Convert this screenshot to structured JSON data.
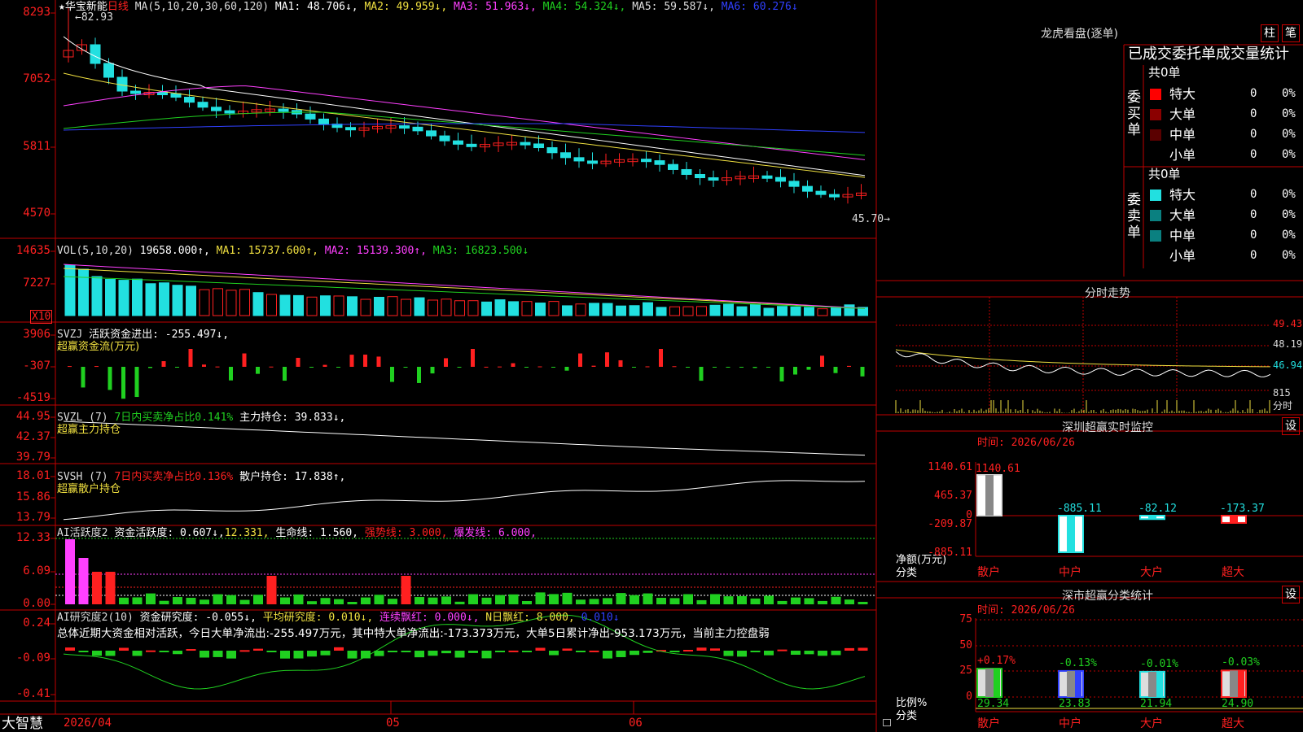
{
  "colors": {
    "up": "#ff2020",
    "down": "#22e0e0",
    "green": "#20d020",
    "grid": "#c00000",
    "yellow": "#f0e040",
    "magenta": "#ff40ff",
    "blue": "#3040ff",
    "white": "#ffffff"
  },
  "app": {
    "name": "大智慧"
  },
  "kline": {
    "yaxis": [
      "8293",
      "7052",
      "5811",
      "4570"
    ],
    "header": {
      "star": "★",
      "stock": "华宝新能",
      "period": "日线",
      "ma_params": "MA(5,10,20,30,60,120)",
      "ma1": "MA1: 48.706↓,",
      "ma2": "MA2: 49.959↓,",
      "ma3": "MA3: 51.963↓,",
      "ma4": "MA4: 54.324↓,",
      "ma5": "MA5: 59.587↓,",
      "ma6": "MA6: 60.276↓"
    },
    "high_label": "82.93",
    "low_label": "45.70"
  },
  "vol": {
    "yaxis": [
      "14635",
      "7227"
    ],
    "unit": "X10",
    "header": {
      "name": "VOL(5,10,20)",
      "val": "19658.000↑,",
      "ma1": "MA1: 15737.600↑,",
      "ma2": "MA2: 15139.300↑,",
      "ma3": "MA3: 16823.500↓"
    }
  },
  "svzj": {
    "yaxis": [
      "3906",
      "-307",
      "-4519"
    ],
    "header": {
      "name": "SVZJ",
      "flow": "活跃资金进出: -255.497↓,",
      "sub": "超赢资金流(万元)"
    }
  },
  "svzl": {
    "yaxis": [
      "44.95",
      "42.37",
      "39.79"
    ],
    "header": {
      "name": "SVZL (7)",
      "ratio": "7日内买卖净占比0.141%",
      "hold": "主力持仓: 39.833↓,",
      "sub": "超赢主力持仓"
    }
  },
  "svsh": {
    "yaxis": [
      "18.01",
      "15.86",
      "13.79"
    ],
    "header": {
      "name": "SVSH (7)",
      "ratio": "7日内买卖净占比0.136%",
      "hold": "散户持仓: 17.838↑,",
      "sub": "超赢散户持仓"
    }
  },
  "ai1": {
    "yaxis": [
      "12.33",
      "6.09",
      "0.00"
    ],
    "header": {
      "name": "AI活跃度2",
      "act": "资金活跃度: 0.607↓,",
      "v2": "12.331,",
      "life": "生命线: 1.560,",
      "strong": "强势线: 3.000,",
      "burst": "爆发线: 6.000,"
    }
  },
  "ai2": {
    "yaxis": [
      "0.24",
      "-0.09",
      "-0.41"
    ],
    "header": {
      "name": "AI研究度2(10)",
      "res": "资金研究度: -0.055↓,",
      "avg": "平均研究度: 0.010↓,",
      "red": "连续飘红: 0.000↓,",
      "nred": "N日飘红: 8.000,",
      "last": "0.010↓"
    },
    "summary": "总体近期大资金相对活跃，今日大单净流出:-255.497万元，其中特大单净流出:-173.373万元，大单5日累计净出-953.173万元，当前主力控盘弱"
  },
  "xaxis": {
    "d1": "2026/04",
    "d2": "05",
    "d3": "06"
  },
  "right": {
    "longhu": {
      "title": "龙虎看盘(逐单)",
      "btn1": "柱",
      "btn2": "笔",
      "subtitle": "已成交委托单成交量统计",
      "buy": {
        "label": "委买单",
        "total": "共0单",
        "rows": [
          {
            "name": "特大",
            "n": "0",
            "p": "0%"
          },
          {
            "name": "大单",
            "n": "0",
            "p": "0%"
          },
          {
            "name": "中单",
            "n": "0",
            "p": "0%"
          },
          {
            "name": "小单",
            "n": "0",
            "p": "0%"
          }
        ]
      },
      "sell": {
        "label": "委卖单",
        "total": "共0单",
        "rows": [
          {
            "name": "特大",
            "n": "0",
            "p": "0%"
          },
          {
            "name": "大单",
            "n": "0",
            "p": "0%"
          },
          {
            "name": "中单",
            "n": "0",
            "p": "0%"
          },
          {
            "name": "小单",
            "n": "0",
            "p": "0%"
          }
        ]
      }
    },
    "fenshi": {
      "title": "分时走势",
      "y": [
        "49.43",
        "48.19",
        "46.94"
      ],
      "vol_label": "815",
      "vol_unit": "分时"
    },
    "monitor": {
      "title": "深圳超赢实时监控",
      "btn": "设",
      "time": "时间: 2026/06/26",
      "yaxis": [
        "1140.61",
        "465.37",
        "0",
        "-209.87",
        "-885.11"
      ],
      "ylabel": "净额(万元)",
      "xlabel": "分类",
      "bars": [
        {
          "name": "散户",
          "value": 1140.61,
          "label": "1140.61"
        },
        {
          "name": "中户",
          "value": -885.11,
          "label": "-885.11"
        },
        {
          "name": "大户",
          "value": -82.12,
          "label": "-82.12"
        },
        {
          "name": "超大",
          "value": -173.37,
          "label": "-173.37"
        }
      ]
    },
    "stats": {
      "title": "深市超赢分类统计",
      "btn": "设",
      "time": "时间: 2026/06/26",
      "yaxis": [
        "75",
        "50",
        "25",
        "0"
      ],
      "ylabel": "比例%",
      "xlabel": "分类",
      "bars": [
        {
          "name": "散户",
          "value": 29.34,
          "label": "29.34",
          "chg": "+0.17%"
        },
        {
          "name": "中户",
          "value": 23.83,
          "label": "23.83",
          "chg": "-0.13%"
        },
        {
          "name": "大户",
          "value": 21.94,
          "label": "21.94",
          "chg": "-0.01%"
        },
        {
          "name": "超大",
          "value": 24.9,
          "label": "24.90",
          "chg": "-0.03%"
        }
      ]
    }
  }
}
